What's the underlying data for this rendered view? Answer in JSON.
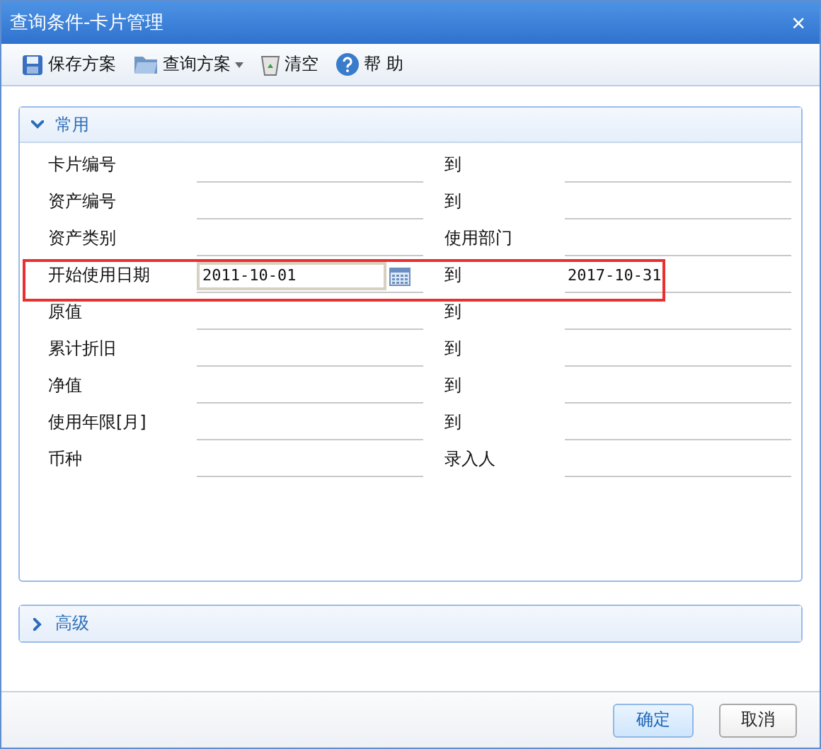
{
  "window": {
    "title": "查询条件-卡片管理",
    "close": "×"
  },
  "toolbar": [
    {
      "label": "保存方案",
      "dropdown": false
    },
    {
      "label": "查询方案",
      "dropdown": true
    },
    {
      "label": "清空",
      "dropdown": false
    },
    {
      "label": "帮 助",
      "dropdown": false
    }
  ],
  "sections": [
    {
      "title": "常用",
      "expanded": true,
      "rows": [
        {
          "label": "卡片编号",
          "field": {
            "kind": "line"
          },
          "right_label": "到",
          "right_field": {
            "kind": "line"
          },
          "highlighted": false
        },
        {
          "label": "资产编号",
          "field": {
            "kind": "line"
          },
          "right_label": "到",
          "right_field": {
            "kind": "line"
          },
          "highlighted": false
        },
        {
          "label": "资产类别",
          "field": {
            "kind": "line"
          },
          "right_label": "使用部门",
          "right_field": {
            "kind": "line"
          },
          "highlighted": false
        },
        {
          "label": "开始使用日期",
          "field": {
            "kind": "date",
            "value": "2011-10-01"
          },
          "right_label": "到",
          "right_field": {
            "kind": "line",
            "value": "2017-10-31"
          },
          "highlighted": true
        },
        {
          "label": "原值",
          "field": {
            "kind": "line"
          },
          "right_label": "到",
          "right_field": {
            "kind": "line"
          },
          "highlighted": false
        },
        {
          "label": "累计折旧",
          "field": {
            "kind": "line"
          },
          "right_label": "到",
          "right_field": {
            "kind": "line"
          },
          "highlighted": false
        },
        {
          "label": "净值",
          "field": {
            "kind": "line"
          },
          "right_label": "到",
          "right_field": {
            "kind": "line"
          },
          "highlighted": false
        },
        {
          "label": "使用年限[月]",
          "field": {
            "kind": "line"
          },
          "right_label": "到",
          "right_field": {
            "kind": "line"
          },
          "highlighted": false
        },
        {
          "label": "币种",
          "field": {
            "kind": "line"
          },
          "right_label": "录入人",
          "right_field": {
            "kind": "line"
          },
          "highlighted": false
        }
      ]
    },
    {
      "title": "高级",
      "expanded": false
    }
  ],
  "buttons": [
    {
      "label": "确定",
      "primary": true
    },
    {
      "label": "取消",
      "primary": false
    }
  ]
}
